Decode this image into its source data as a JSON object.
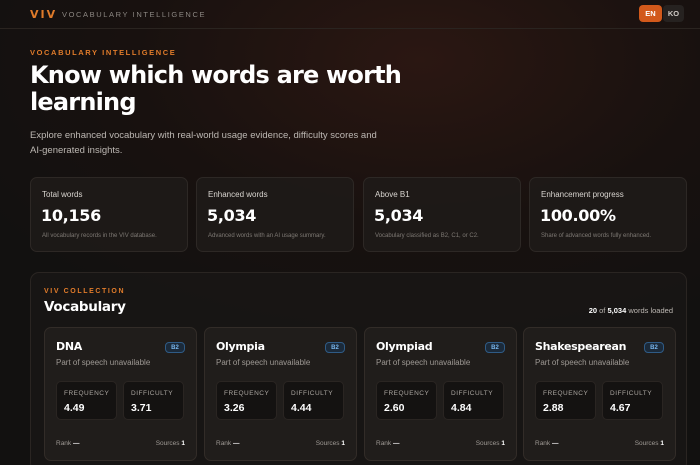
{
  "topbar": {
    "logo": "VIV",
    "subtitle": "VOCABULARY INTELLIGENCE",
    "lang_en": "EN",
    "lang_ko": "KO"
  },
  "hero": {
    "eyebrow": "VOCABULARY INTELLIGENCE",
    "title": "Know which words are worth learning",
    "description": "Explore enhanced vocabulary with real-world usage evidence, difficulty scores and AI-generated insights."
  },
  "stats": [
    {
      "label": "Total words",
      "value": "10,156",
      "desc": "All vocabulary records in the VIV database."
    },
    {
      "label": "Enhanced words",
      "value": "5,034",
      "desc": "Advanced words with an AI usage summary."
    },
    {
      "label": "Above B1",
      "value": "5,034",
      "desc": "Vocabulary classified as B2, C1, or C2."
    },
    {
      "label": "Enhancement progress",
      "value": "100.00%",
      "desc": "Share of advanced words fully enhanced."
    }
  ],
  "collection": {
    "eyebrow": "VIV COLLECTION",
    "title": "Vocabulary",
    "loaded": "20",
    "of": "of",
    "total": "5,034",
    "suffix": "words loaded"
  },
  "labels": {
    "frequency": "FREQUENCY",
    "difficulty": "DIFFICULTY",
    "rank": "Rank",
    "sources": "Sources"
  },
  "cards": [
    {
      "word": "DNA",
      "level": "B2",
      "pos": "Part of speech unavailable",
      "frequency": "4.49",
      "difficulty": "3.71",
      "rank": "—",
      "sources": "1"
    },
    {
      "word": "Olympia",
      "level": "B2",
      "pos": "Part of speech unavailable",
      "frequency": "3.26",
      "difficulty": "4.44",
      "rank": "—",
      "sources": "1"
    },
    {
      "word": "Olympiad",
      "level": "B2",
      "pos": "Part of speech unavailable",
      "frequency": "2.60",
      "difficulty": "4.84",
      "rank": "—",
      "sources": "1"
    },
    {
      "word": "Shakespearean",
      "level": "B2",
      "pos": "Part of speech unavailable",
      "frequency": "2.88",
      "difficulty": "4.67",
      "rank": "—",
      "sources": "1"
    }
  ]
}
